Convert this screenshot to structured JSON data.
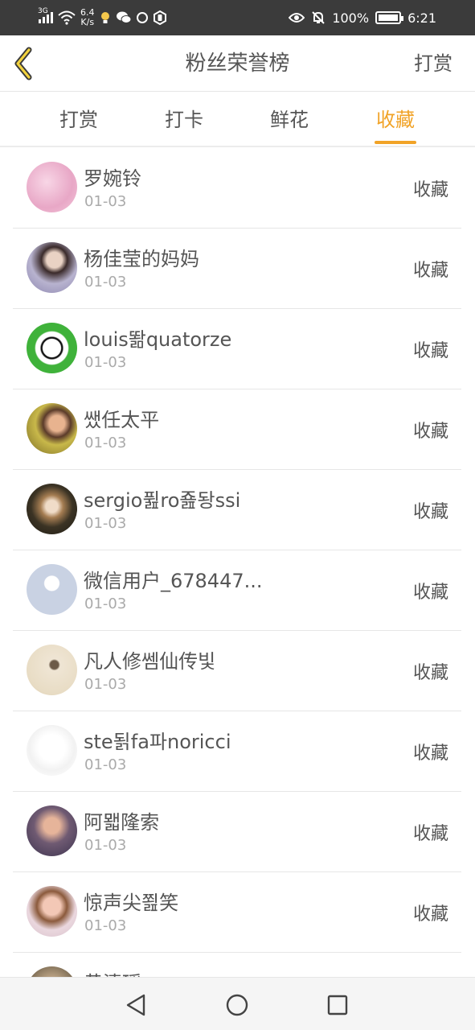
{
  "status_bar": {
    "network_type": "3G",
    "speed_value": "6.4",
    "speed_unit": "K/s",
    "battery": "100%",
    "time": "6:21",
    "icons": [
      "signal-icon",
      "wifi-icon",
      "bulb-icon",
      "wechat-icon",
      "voice-icon",
      "hand-icon",
      "eye-icon",
      "mute-bell-icon",
      "battery-icon"
    ]
  },
  "header": {
    "title": "粉丝荣誉榜",
    "action": "打赏",
    "back_icon": "chevron-left-icon"
  },
  "tabs": [
    {
      "label": "打赏",
      "active": false
    },
    {
      "label": "打卡",
      "active": false
    },
    {
      "label": "鲜花",
      "active": false
    },
    {
      "label": "收藏",
      "active": true
    }
  ],
  "list": [
    {
      "name": "罗婉铃",
      "date": "01-03",
      "type": "收藏"
    },
    {
      "name": "杨佳莹的妈妈",
      "date": "01-03",
      "type": "收藏"
    },
    {
      "name": "louis똶quatorze",
      "date": "01-03",
      "type": "收藏"
    },
    {
      "name": "쌨任太平",
      "date": "01-03",
      "type": "收藏"
    },
    {
      "name": "sergio퓚ro죮돵ssi",
      "date": "01-03",
      "type": "收藏"
    },
    {
      "name": "微信用户_678447...",
      "date": "01-03",
      "type": "收藏"
    },
    {
      "name": "凡人修쎔仙传빛",
      "date": "01-03",
      "type": "收藏"
    },
    {
      "name": "ste됡fa파noricci",
      "date": "01-03",
      "type": "收藏"
    },
    {
      "name": "阿뫫隆索",
      "date": "01-03",
      "type": "收藏"
    },
    {
      "name": "惊声尖쬞笑",
      "date": "01-03",
      "type": "收藏"
    },
    {
      "name": "黄清瑶",
      "date": "",
      "type": ""
    }
  ],
  "colors": {
    "accent": "#f1a327",
    "status_bar_bg": "#3b3b3b",
    "text": "#555555",
    "subtext": "#aaaaaa",
    "divider": "#e6e6e6"
  },
  "nav": {
    "icons": [
      "back-triangle-icon",
      "home-circle-icon",
      "recents-square-icon"
    ]
  }
}
